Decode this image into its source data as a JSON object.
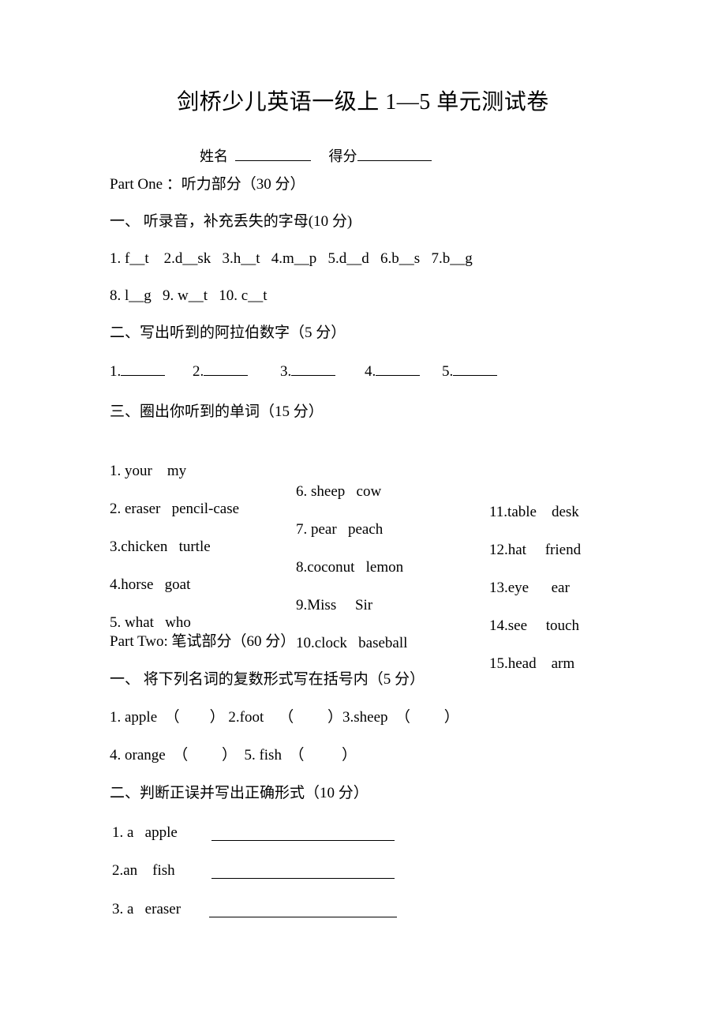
{
  "document": {
    "title": "剑桥少儿英语一级上 1—5 单元测试卷",
    "header_fields": {
      "name_label": "姓名",
      "score_label": "得分"
    }
  },
  "part_one": {
    "heading": "Part One ：听力部分（30 分）",
    "section1": {
      "heading": "一、 听录音，补充丢失的字母(10 分)",
      "line1": "1. f__t    2.d__sk   3.h__t   4.m__p   5.d__d   6.b__s   7.b__g",
      "line2": "8. l__g   9. w__t   10. c__t"
    },
    "section2": {
      "heading": "二、写出听到的阿拉伯数字（5 分）",
      "items": [
        "1.",
        "2.",
        "3.",
        "4.",
        "5."
      ]
    },
    "section3": {
      "heading": "三、圈出你听到的单词（15 分）",
      "rows": [
        {
          "col1": "1. your    my",
          "col2": "6. sheep   cow",
          "col3": "11.table    desk"
        },
        {
          "col1": "2. eraser   pencil-case",
          "col2": "7. pear   peach",
          "col3": "12.hat     friend"
        },
        {
          "col1": "3.chicken   turtle",
          "col2": "8.coconut   lemon",
          "col3": "13.eye      ear"
        },
        {
          "col1": "4.horse   goat",
          "col2": "9.Miss     Sir",
          "col3": "14.see     touch"
        },
        {
          "col1": "5. what   who",
          "col2": "10.clock   baseball",
          "col3": "15.head    arm"
        }
      ]
    }
  },
  "part_two": {
    "heading": "Part Two: 笔试部分（60 分）",
    "section1": {
      "heading": "一、 将下列名词的复数形式写在括号内（5 分）",
      "line1": "1. apple  （        ） 2.foot    （         ）3.sheep  （         ）",
      "line2": "4. orange  （         ）  5. fish  （          ）"
    },
    "section2": {
      "heading": "二、判断正误并写出正确形式（10 分）",
      "items": [
        {
          "text": "1. a   apple"
        },
        {
          "text": "2.an    fish"
        },
        {
          "text": "3. a   eraser"
        }
      ]
    }
  }
}
